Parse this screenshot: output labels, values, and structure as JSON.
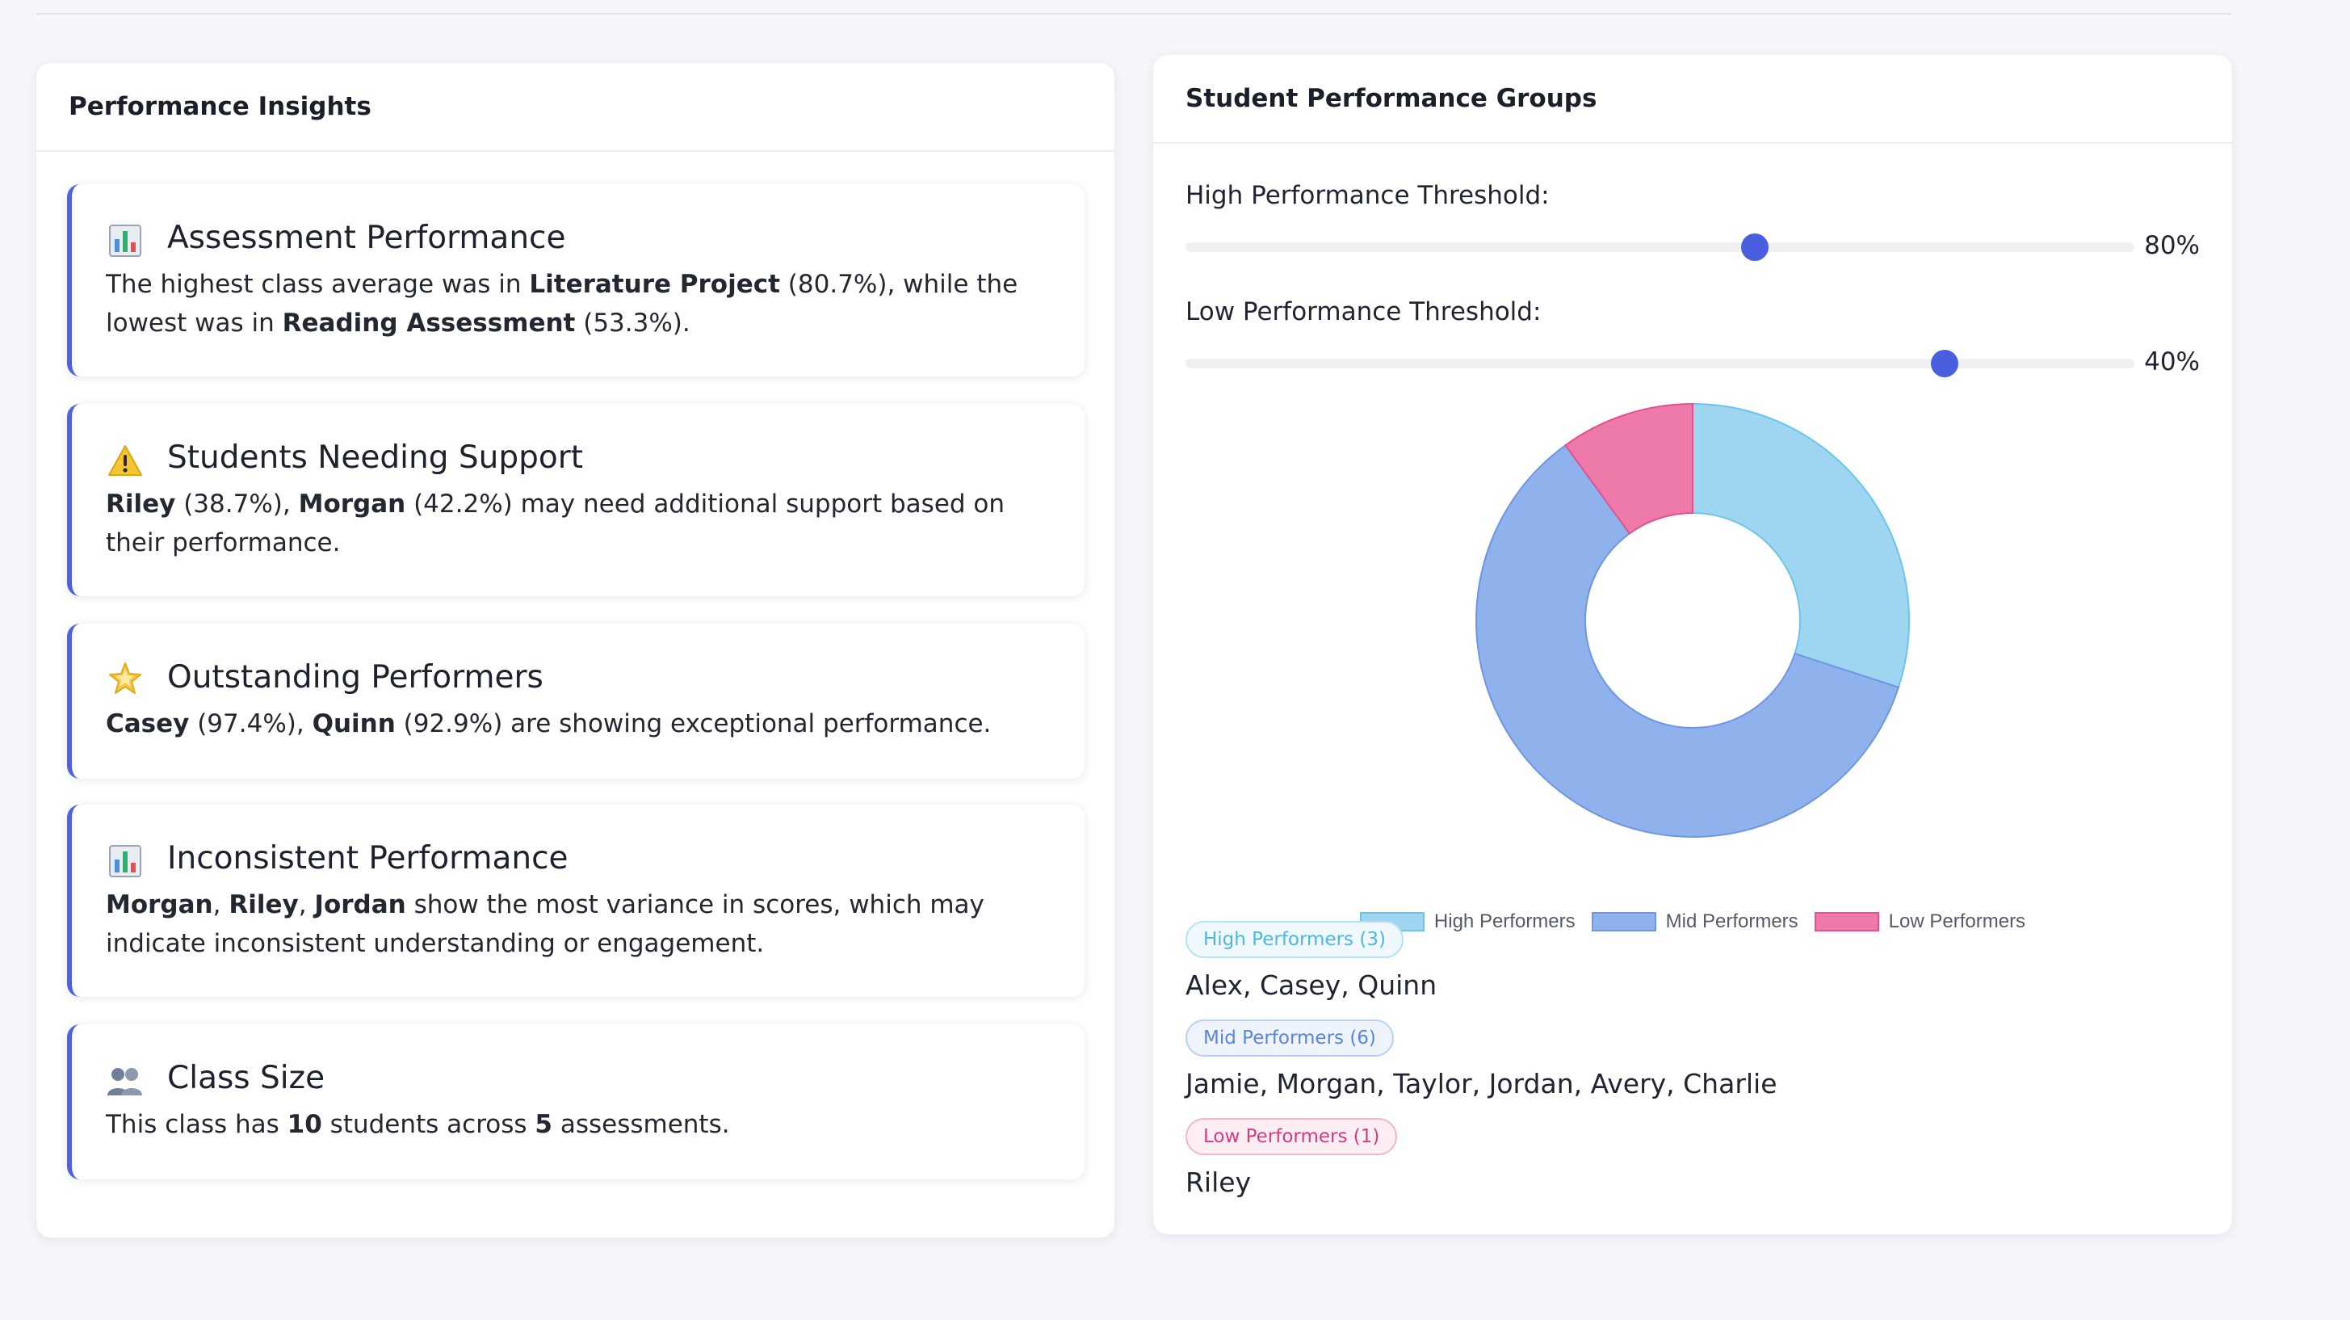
{
  "insights": {
    "title": "Performance Insights",
    "cards": [
      {
        "icon": "bar-chart-icon",
        "title": "Assessment Performance",
        "t1": "The highest class average was in ",
        "b1": "Literature Project",
        "t2": " (80.7%), while the lowest was in ",
        "b2": "Reading Assessment",
        "t3": " (53.3%)."
      },
      {
        "icon": "warning-icon",
        "title": "Students Needing Support",
        "b1": "Riley",
        "t1": " (38.7%), ",
        "b2": "Morgan",
        "t2": " (42.2%) may need additional support based on their performance."
      },
      {
        "icon": "star-icon",
        "title": "Outstanding Performers",
        "b1": "Casey",
        "t1": " (97.4%), ",
        "b2": "Quinn",
        "t2": " (92.9%) are showing exceptional performance."
      },
      {
        "icon": "bar-chart-icon",
        "title": "Inconsistent Performance",
        "b1": "Morgan",
        "t1": ", ",
        "b2": "Riley",
        "t2": ", ",
        "b3": "Jordan",
        "t3": " show the most variance in scores, which may indicate inconsistent understanding or engagement."
      },
      {
        "icon": "people-icon",
        "title": "Class Size",
        "t1": "This class has ",
        "b1": "10",
        "t2": " students across ",
        "b2": "5",
        "t3": " assessments."
      }
    ]
  },
  "groups": {
    "title": "Student Performance Groups",
    "high_threshold": {
      "label": "High Performance Threshold:",
      "value": 80,
      "display": "80%"
    },
    "low_threshold": {
      "label": "Low Performance Threshold:",
      "value": 40,
      "display": "40%"
    },
    "lists": [
      {
        "badge": "High Performers (3)",
        "names": "Alex, Casey, Quinn"
      },
      {
        "badge": "Mid Performers (6)",
        "names": "Jamie, Morgan, Taylor, Jordan, Avery, Charlie"
      },
      {
        "badge": "Low Performers (1)",
        "names": "Riley"
      }
    ]
  },
  "chart_data": {
    "type": "pie",
    "variant": "doughnut",
    "categories": [
      "High Performers",
      "Mid Performers",
      "Low Performers"
    ],
    "values": [
      3,
      6,
      1
    ],
    "colors": [
      "#9ed6f2",
      "#8fb2ec",
      "#ee7aab"
    ],
    "border_colors": [
      "#6cc4ea",
      "#6e96e2",
      "#e5508f"
    ],
    "legend_position": "bottom"
  },
  "colors": {
    "accent": "#4f63e0",
    "high": "#4fb6e0",
    "mid": "#5b86d8",
    "low": "#d83a7c"
  }
}
